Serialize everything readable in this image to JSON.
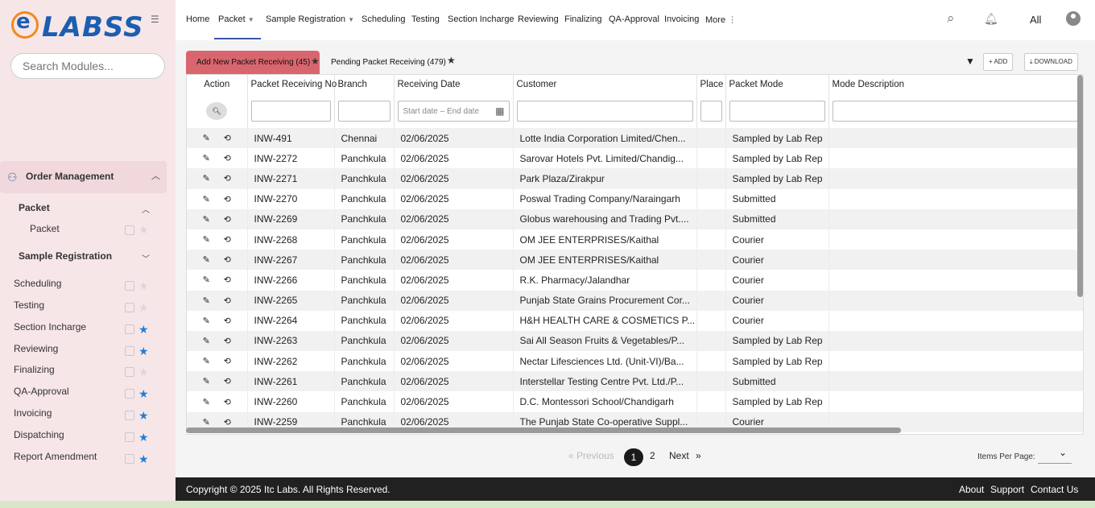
{
  "brand": {
    "logo_text": "LABSS",
    "logo_letter": "e"
  },
  "sidebar": {
    "search_placeholder": "Search Modules...",
    "section": "Order Management",
    "groups": [
      {
        "label": "Packet",
        "items": [
          {
            "label": "Packet",
            "starred": false
          }
        ]
      },
      {
        "label": "Sample Registration",
        "items": []
      }
    ],
    "items": [
      {
        "label": "Scheduling",
        "starred": false
      },
      {
        "label": "Testing",
        "starred": false
      },
      {
        "label": "Section Incharge",
        "starred": true
      },
      {
        "label": "Reviewing",
        "starred": true
      },
      {
        "label": "Finalizing",
        "starred": false
      },
      {
        "label": "QA-Approval",
        "starred": true
      },
      {
        "label": "Invoicing",
        "starred": true
      },
      {
        "label": "Dispatching",
        "starred": true
      },
      {
        "label": "Report Amendment",
        "starred": true
      }
    ]
  },
  "nav": {
    "items": [
      "Home",
      "Packet",
      "Sample Registration",
      "Scheduling",
      "Testing",
      "Section Incharge",
      "Reviewing",
      "Finalizing",
      "QA-Approval",
      "Invoicing",
      "More"
    ],
    "active": "Packet",
    "scope": "All"
  },
  "tabs": {
    "active": "Add New Packet Receiving (45)",
    "pending": "Pending Packet Receiving (479)"
  },
  "toolbar": {
    "add": "+ ADD",
    "download": "⤓ DOWNLOAD"
  },
  "table": {
    "columns": [
      "Action",
      "Packet Receiving No",
      "Branch",
      "Receiving Date",
      "Customer",
      "Place",
      "Packet Mode",
      "Mode Description"
    ],
    "date_filter": {
      "start": "Start date",
      "separator": "–",
      "end": "End date"
    },
    "rows": [
      [
        "INW-491",
        "Chennai",
        "02/06/2025",
        "Lotte India Corporation Limited/Chen...",
        "",
        "Sampled by Lab Rep",
        ""
      ],
      [
        "INW-2272",
        "Panchkula",
        "02/06/2025",
        "Sarovar Hotels Pvt. Limited/Chandig...",
        "",
        "Sampled by Lab Rep",
        ""
      ],
      [
        "INW-2271",
        "Panchkula",
        "02/06/2025",
        "Park Plaza/Zirakpur",
        "",
        "Sampled by Lab Rep",
        ""
      ],
      [
        "INW-2270",
        "Panchkula",
        "02/06/2025",
        "Poswal Trading Company/Naraingarh",
        "",
        "Submitted",
        ""
      ],
      [
        "INW-2269",
        "Panchkula",
        "02/06/2025",
        "Globus warehousing and Trading Pvt....",
        "",
        "Submitted",
        ""
      ],
      [
        "INW-2268",
        "Panchkula",
        "02/06/2025",
        "OM JEE ENTERPRISES/Kaithal",
        "",
        "Courier",
        ""
      ],
      [
        "INW-2267",
        "Panchkula",
        "02/06/2025",
        "OM JEE ENTERPRISES/Kaithal",
        "",
        "Courier",
        ""
      ],
      [
        "INW-2266",
        "Panchkula",
        "02/06/2025",
        "R.K. Pharmacy/Jalandhar",
        "",
        "Courier",
        ""
      ],
      [
        "INW-2265",
        "Panchkula",
        "02/06/2025",
        "Punjab State Grains Procurement Cor...",
        "",
        "Courier",
        ""
      ],
      [
        "INW-2264",
        "Panchkula",
        "02/06/2025",
        "H&H HEALTH CARE & COSMETICS P...",
        "",
        "Courier",
        ""
      ],
      [
        "INW-2263",
        "Panchkula",
        "02/06/2025",
        "Sai All Season Fruits & Vegetables/P...",
        "",
        "Sampled by Lab Rep",
        ""
      ],
      [
        "INW-2262",
        "Panchkula",
        "02/06/2025",
        "Nectar Lifesciences Ltd. (Unit-VI)/Ba...",
        "",
        "Sampled by Lab Rep",
        ""
      ],
      [
        "INW-2261",
        "Panchkula",
        "02/06/2025",
        "Interstellar Testing Centre Pvt. Ltd./P...",
        "",
        "Submitted",
        ""
      ],
      [
        "INW-2260",
        "Panchkula",
        "02/06/2025",
        "D.C. Montessori School/Chandigarh",
        "",
        "Sampled by Lab Rep",
        ""
      ],
      [
        "INW-2259",
        "Panchkula",
        "02/06/2025",
        "The Punjab State Co-operative Suppl...",
        "",
        "Courier",
        ""
      ]
    ]
  },
  "pagination": {
    "prev": "« Previous",
    "pages": [
      "1",
      "2"
    ],
    "current": "1",
    "next": "Next",
    "next_arrow": "»",
    "items_per_page": "Items Per Page:"
  },
  "footer": {
    "copyright": "Copyright © 2025 Itc Labs. All Rights Reserved.",
    "links": [
      "About",
      "Support",
      "Contact Us"
    ]
  },
  "colors": {
    "active_tab": "#d9666e",
    "sidebar_bg": "#f7e6e8",
    "footer_bg": "#212121",
    "star_on": "#1e7fd8"
  }
}
